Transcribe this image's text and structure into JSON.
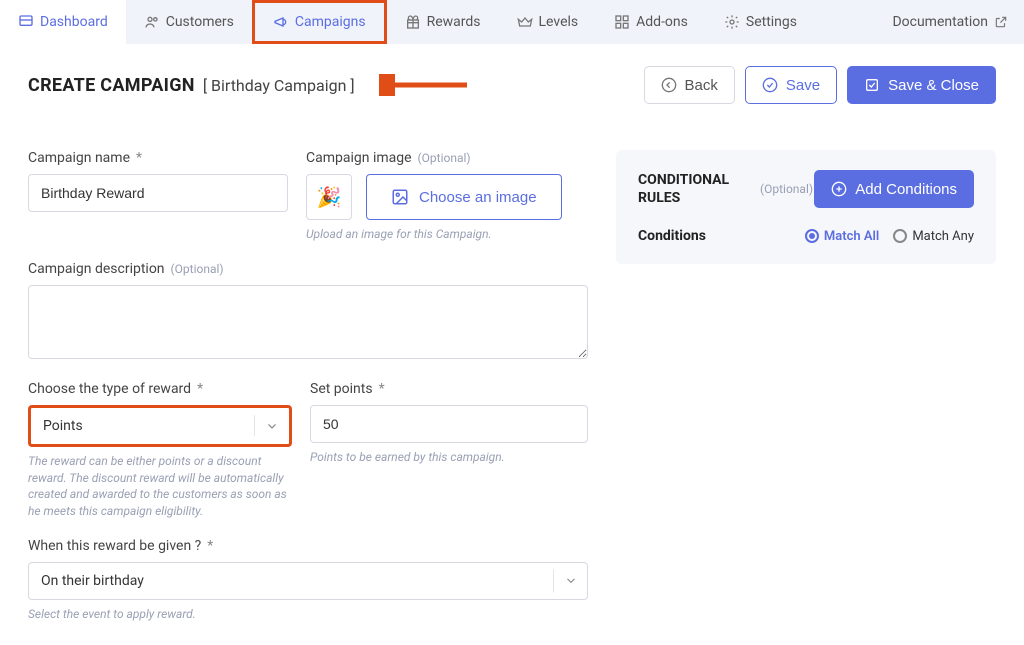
{
  "nav": {
    "items": [
      {
        "label": "Dashboard",
        "icon": "dashboard"
      },
      {
        "label": "Customers",
        "icon": "users"
      },
      {
        "label": "Campaigns",
        "icon": "megaphone"
      },
      {
        "label": "Rewards",
        "icon": "gift"
      },
      {
        "label": "Levels",
        "icon": "levels"
      },
      {
        "label": "Add-ons",
        "icon": "grid"
      },
      {
        "label": "Settings",
        "icon": "gear"
      }
    ],
    "documentation": "Documentation"
  },
  "header": {
    "title": "CREATE CAMPAIGN",
    "subtitle": "[ Birthday Campaign ]",
    "back": "Back",
    "save": "Save",
    "save_close": "Save & Close"
  },
  "form": {
    "campaign_name": {
      "label": "Campaign name",
      "required": "*",
      "value": "Birthday Reward"
    },
    "campaign_image": {
      "label": "Campaign image",
      "optional": "(Optional)",
      "button": "Choose an image",
      "help": "Upload an image for this Campaign."
    },
    "campaign_description": {
      "label": "Campaign description",
      "optional": "(Optional)",
      "value": ""
    },
    "reward_type": {
      "label": "Choose the type of reward",
      "required": "*",
      "value": "Points",
      "help": "The reward can be either points or a discount reward. The discount reward will be automatically created and awarded to the customers as soon as he meets this campaign eligibility."
    },
    "set_points": {
      "label": "Set points",
      "required": "*",
      "value": "50",
      "help": "Points to be earned by this campaign."
    },
    "when_given": {
      "label": "When this reward be given ?",
      "required": "*",
      "value": "On their birthday",
      "help": "Select the event to apply reward."
    }
  },
  "sidebar": {
    "title": "CONDITIONAL RULES",
    "optional": "(Optional)",
    "add_button": "Add Conditions",
    "conditions_label": "Conditions",
    "match_all": "Match All",
    "match_any": "Match Any"
  }
}
